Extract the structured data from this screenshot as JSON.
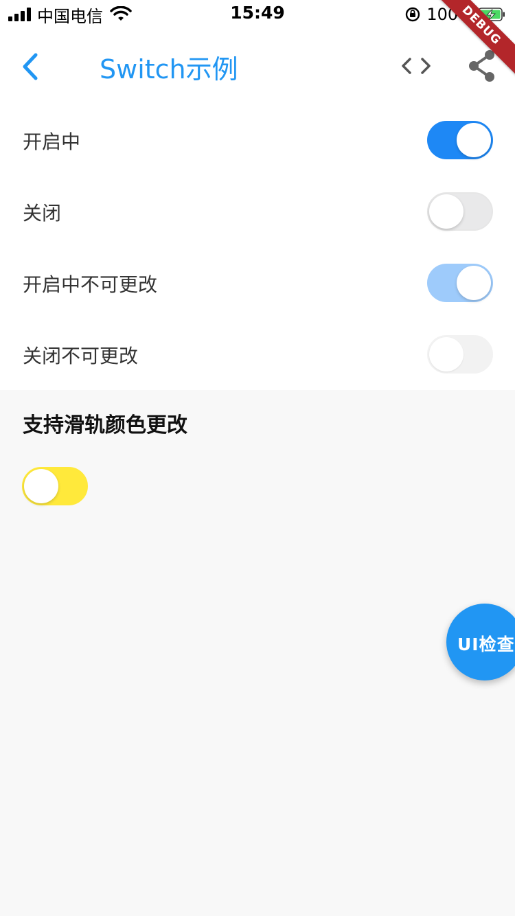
{
  "status_bar": {
    "carrier": "中国电信",
    "time": "15:49",
    "battery_percent": "100%",
    "battery_level": 1.0
  },
  "app_bar": {
    "title": "Switch示例",
    "back_icon": "chevron-left-icon",
    "code_icon": "code-icon",
    "share_icon": "share-icon",
    "accent_color": "#2196f3"
  },
  "switches": [
    {
      "label": "开启中",
      "state": "on",
      "enabled": true,
      "track_color": "#1e88f5"
    },
    {
      "label": "关闭",
      "state": "off",
      "enabled": true,
      "track_color": "#e9e9ea"
    },
    {
      "label": "开启中不可更改",
      "state": "on",
      "enabled": false,
      "track_color": "#9ecbfb"
    },
    {
      "label": "关闭不可更改",
      "state": "off",
      "enabled": false,
      "track_color": "#f2f2f2"
    }
  ],
  "track_section": {
    "title": "支持滑轨颜色更改",
    "switch_state": "off",
    "track_color": "#ffe93b"
  },
  "fab": {
    "label": "UI检查",
    "color": "#2196f3"
  },
  "debug_banner": {
    "label": "DEBUG",
    "color": "#b3262a"
  }
}
